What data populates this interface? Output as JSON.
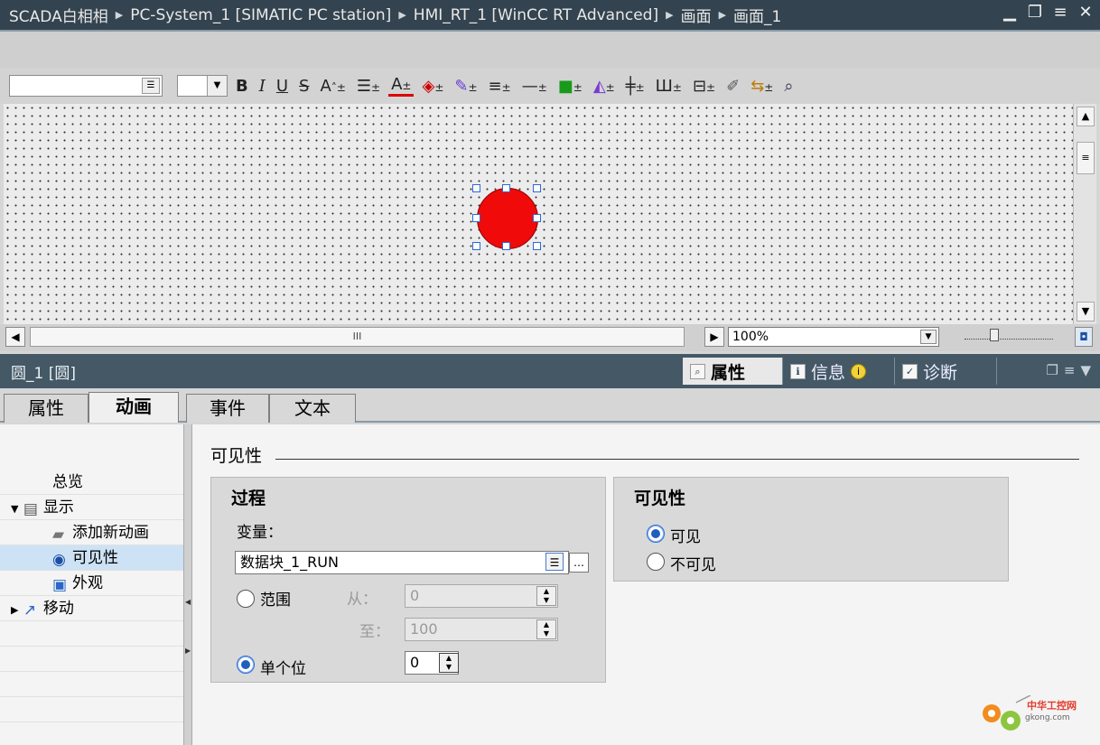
{
  "titlebar": {
    "crumbs": [
      "SCADA白相相",
      "PC-System_1 [SIMATIC PC station]",
      "HMI_RT_1 [WinCC RT Advanced]",
      "画面",
      "画面_1"
    ],
    "buttons": [
      "minimize",
      "restore",
      "maximize",
      "close"
    ]
  },
  "format_toolbar": {
    "bold": "B",
    "italic": "I",
    "underline": "U",
    "strike": "S",
    "font_grow": "A",
    "text_color": "A"
  },
  "canvas": {
    "shape": "circle",
    "fill_color": "#f00a0a",
    "zoom": "100%",
    "hscroll_grip": "III"
  },
  "inspector": {
    "title": "圆_1 [圆]",
    "tabs_right": [
      {
        "label": "属性",
        "active": true
      },
      {
        "label": "信息",
        "active": false
      },
      {
        "label": "诊断",
        "active": false
      }
    ],
    "tabs": [
      {
        "label": "属性",
        "active": false
      },
      {
        "label": "动画",
        "active": true
      },
      {
        "label": "事件",
        "active": false
      },
      {
        "label": "文本",
        "active": false
      }
    ]
  },
  "nav": {
    "items": [
      {
        "label": "总览"
      },
      {
        "label": "显示"
      },
      {
        "label": "添加新动画"
      },
      {
        "label": "可见性",
        "selected": true
      },
      {
        "label": "外观"
      },
      {
        "label": "移动"
      }
    ]
  },
  "content": {
    "section_title": "可见性",
    "process": {
      "title": "过程",
      "variable_label": "变量：",
      "variable_value": "数据块_1_RUN",
      "range_label": "范围",
      "from_label": "从：",
      "from_value": "0",
      "to_label": "至：",
      "to_value": "100",
      "single_bit_label": "单个位",
      "single_bit_value": "0",
      "selected_mode": "单个位"
    },
    "visibility": {
      "title": "可见性",
      "options": [
        "可见",
        "不可见"
      ],
      "selected": "可见"
    }
  },
  "watermark": {
    "text": "中华工控网",
    "url_text": "gkong.com"
  }
}
